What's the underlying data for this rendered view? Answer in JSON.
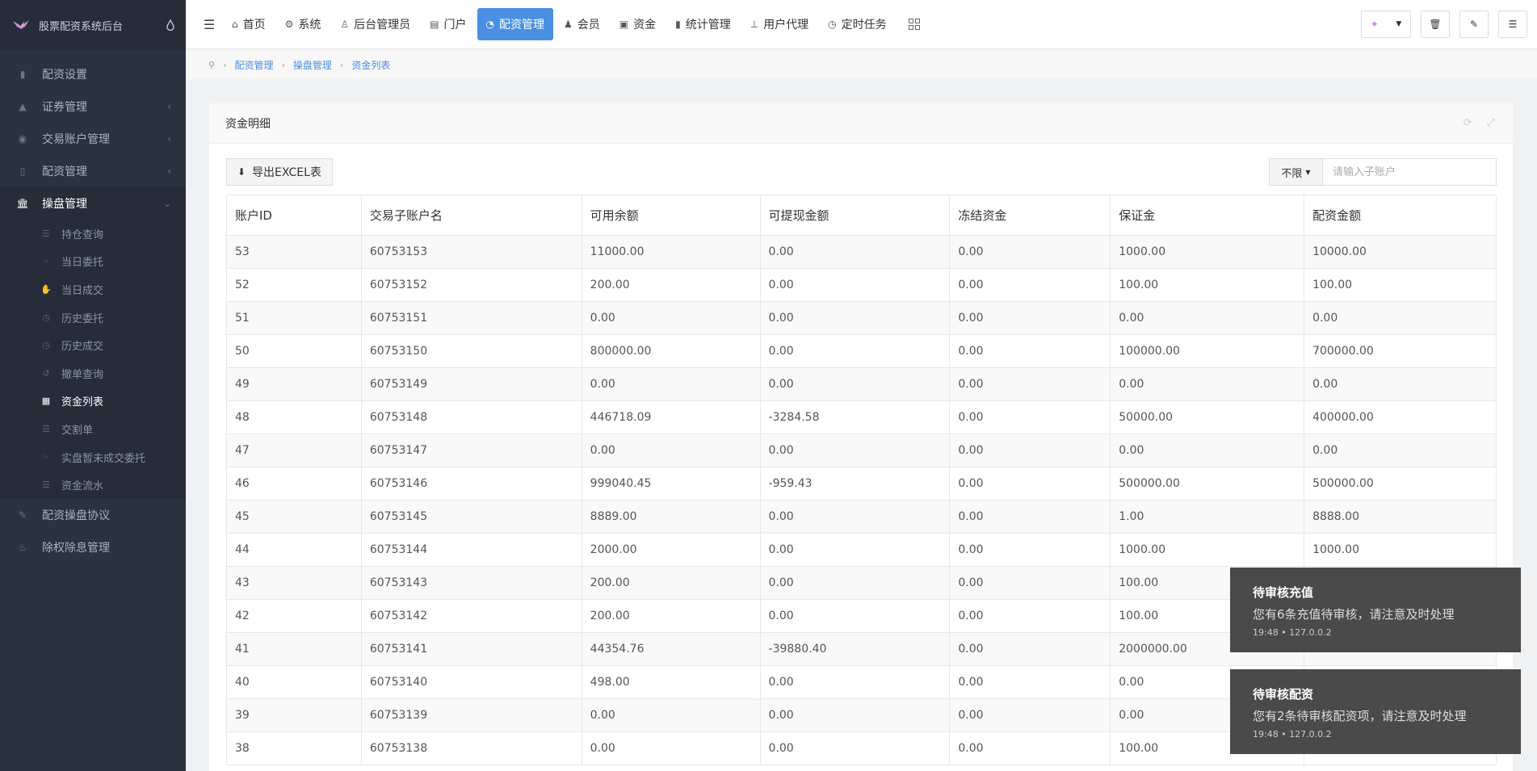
{
  "app": {
    "title": "股票配资系统后台"
  },
  "colors": {
    "accent": "#4a90e2",
    "sidebar_bg": "#2b3240",
    "toast_bg": "#4a4a4a"
  },
  "sidebar": {
    "items": [
      {
        "label": "配资设置",
        "icon": "bar-chart-icon",
        "arrow": ""
      },
      {
        "label": "证券管理",
        "icon": "area-chart-icon",
        "arrow": "‹"
      },
      {
        "label": "交易账户管理",
        "icon": "user-circle-icon",
        "arrow": "‹"
      },
      {
        "label": "配资管理",
        "icon": "thermometer-icon",
        "arrow": "‹"
      },
      {
        "label": "操盘管理",
        "icon": "bank-icon",
        "arrow": "⌄"
      }
    ],
    "sub_items": [
      {
        "label": "持仓查询",
        "icon": "list-icon"
      },
      {
        "label": "当日委托",
        "icon": "hand-icon"
      },
      {
        "label": "当日成交",
        "icon": "handshake-icon"
      },
      {
        "label": "历史委托",
        "icon": "clock-icon"
      },
      {
        "label": "历史成交",
        "icon": "clock-icon"
      },
      {
        "label": "撤单查询",
        "icon": "undo-icon"
      },
      {
        "label": "资金列表",
        "icon": "table-icon"
      },
      {
        "label": "交割单",
        "icon": "list-icon"
      },
      {
        "label": "实盘暂未成交委托",
        "icon": "hand-icon"
      },
      {
        "label": "资金流水",
        "icon": "list-icon"
      }
    ],
    "bottom_items": [
      {
        "label": "配资操盘协议",
        "icon": "pencil-icon"
      },
      {
        "label": "除权除息管理",
        "icon": "fire-icon"
      }
    ]
  },
  "topnav": {
    "items": [
      {
        "label": "首页",
        "icon": "home-icon"
      },
      {
        "label": "系统",
        "icon": "gear-icon"
      },
      {
        "label": "后台管理员",
        "icon": "user-icon"
      },
      {
        "label": "门户",
        "icon": "newspaper-icon"
      },
      {
        "label": "配资管理",
        "icon": "pie-chart-icon"
      },
      {
        "label": "会员",
        "icon": "users-icon"
      },
      {
        "label": "资金",
        "icon": "money-icon"
      },
      {
        "label": "统计管理",
        "icon": "bar-chart-icon"
      },
      {
        "label": "用户代理",
        "icon": "sitemap-icon"
      },
      {
        "label": "定时任务",
        "icon": "clock-icon"
      }
    ]
  },
  "breadcrumb": [
    "配资管理",
    "操盘管理",
    "资金列表"
  ],
  "card": {
    "title": "资金明细",
    "export_label": "导出EXCEL表",
    "filter_select": "不限",
    "search_placeholder": "请输入子账户"
  },
  "table": {
    "headers": [
      "账户ID",
      "交易子账户名",
      "可用余额",
      "可提现金额",
      "冻结资金",
      "保证金",
      "配资金额"
    ],
    "rows": [
      [
        "53",
        "60753153",
        "11000.00",
        "0.00",
        "0.00",
        "1000.00",
        "10000.00"
      ],
      [
        "52",
        "60753152",
        "200.00",
        "0.00",
        "0.00",
        "100.00",
        "100.00"
      ],
      [
        "51",
        "60753151",
        "0.00",
        "0.00",
        "0.00",
        "0.00",
        "0.00"
      ],
      [
        "50",
        "60753150",
        "800000.00",
        "0.00",
        "0.00",
        "100000.00",
        "700000.00"
      ],
      [
        "49",
        "60753149",
        "0.00",
        "0.00",
        "0.00",
        "0.00",
        "0.00"
      ],
      [
        "48",
        "60753148",
        "446718.09",
        "-3284.58",
        "0.00",
        "50000.00",
        "400000.00"
      ],
      [
        "47",
        "60753147",
        "0.00",
        "0.00",
        "0.00",
        "0.00",
        "0.00"
      ],
      [
        "46",
        "60753146",
        "999040.45",
        "-959.43",
        "0.00",
        "500000.00",
        "500000.00"
      ],
      [
        "45",
        "60753145",
        "8889.00",
        "0.00",
        "0.00",
        "1.00",
        "8888.00"
      ],
      [
        "44",
        "60753144",
        "2000.00",
        "0.00",
        "0.00",
        "1000.00",
        "1000.00"
      ],
      [
        "43",
        "60753143",
        "200.00",
        "0.00",
        "0.00",
        "100.00",
        ""
      ],
      [
        "42",
        "60753142",
        "200.00",
        "0.00",
        "0.00",
        "100.00",
        ""
      ],
      [
        "41",
        "60753141",
        "44354.76",
        "-39880.40",
        "0.00",
        "2000000.00",
        ""
      ],
      [
        "40",
        "60753140",
        "498.00",
        "0.00",
        "0.00",
        "0.00",
        ""
      ],
      [
        "39",
        "60753139",
        "0.00",
        "0.00",
        "0.00",
        "0.00",
        ""
      ],
      [
        "38",
        "60753138",
        "0.00",
        "0.00",
        "0.00",
        "100.00",
        ""
      ]
    ]
  },
  "toasts": [
    {
      "title": "待审核充值",
      "message": "您有6条充值待审核，请注意及时处理",
      "meta": "19:48 • 127.0.0.2"
    },
    {
      "title": "待审核配资",
      "message": "您有2条待审核配资项，请注意及时处理",
      "meta": "19:48 • 127.0.0.2"
    }
  ]
}
